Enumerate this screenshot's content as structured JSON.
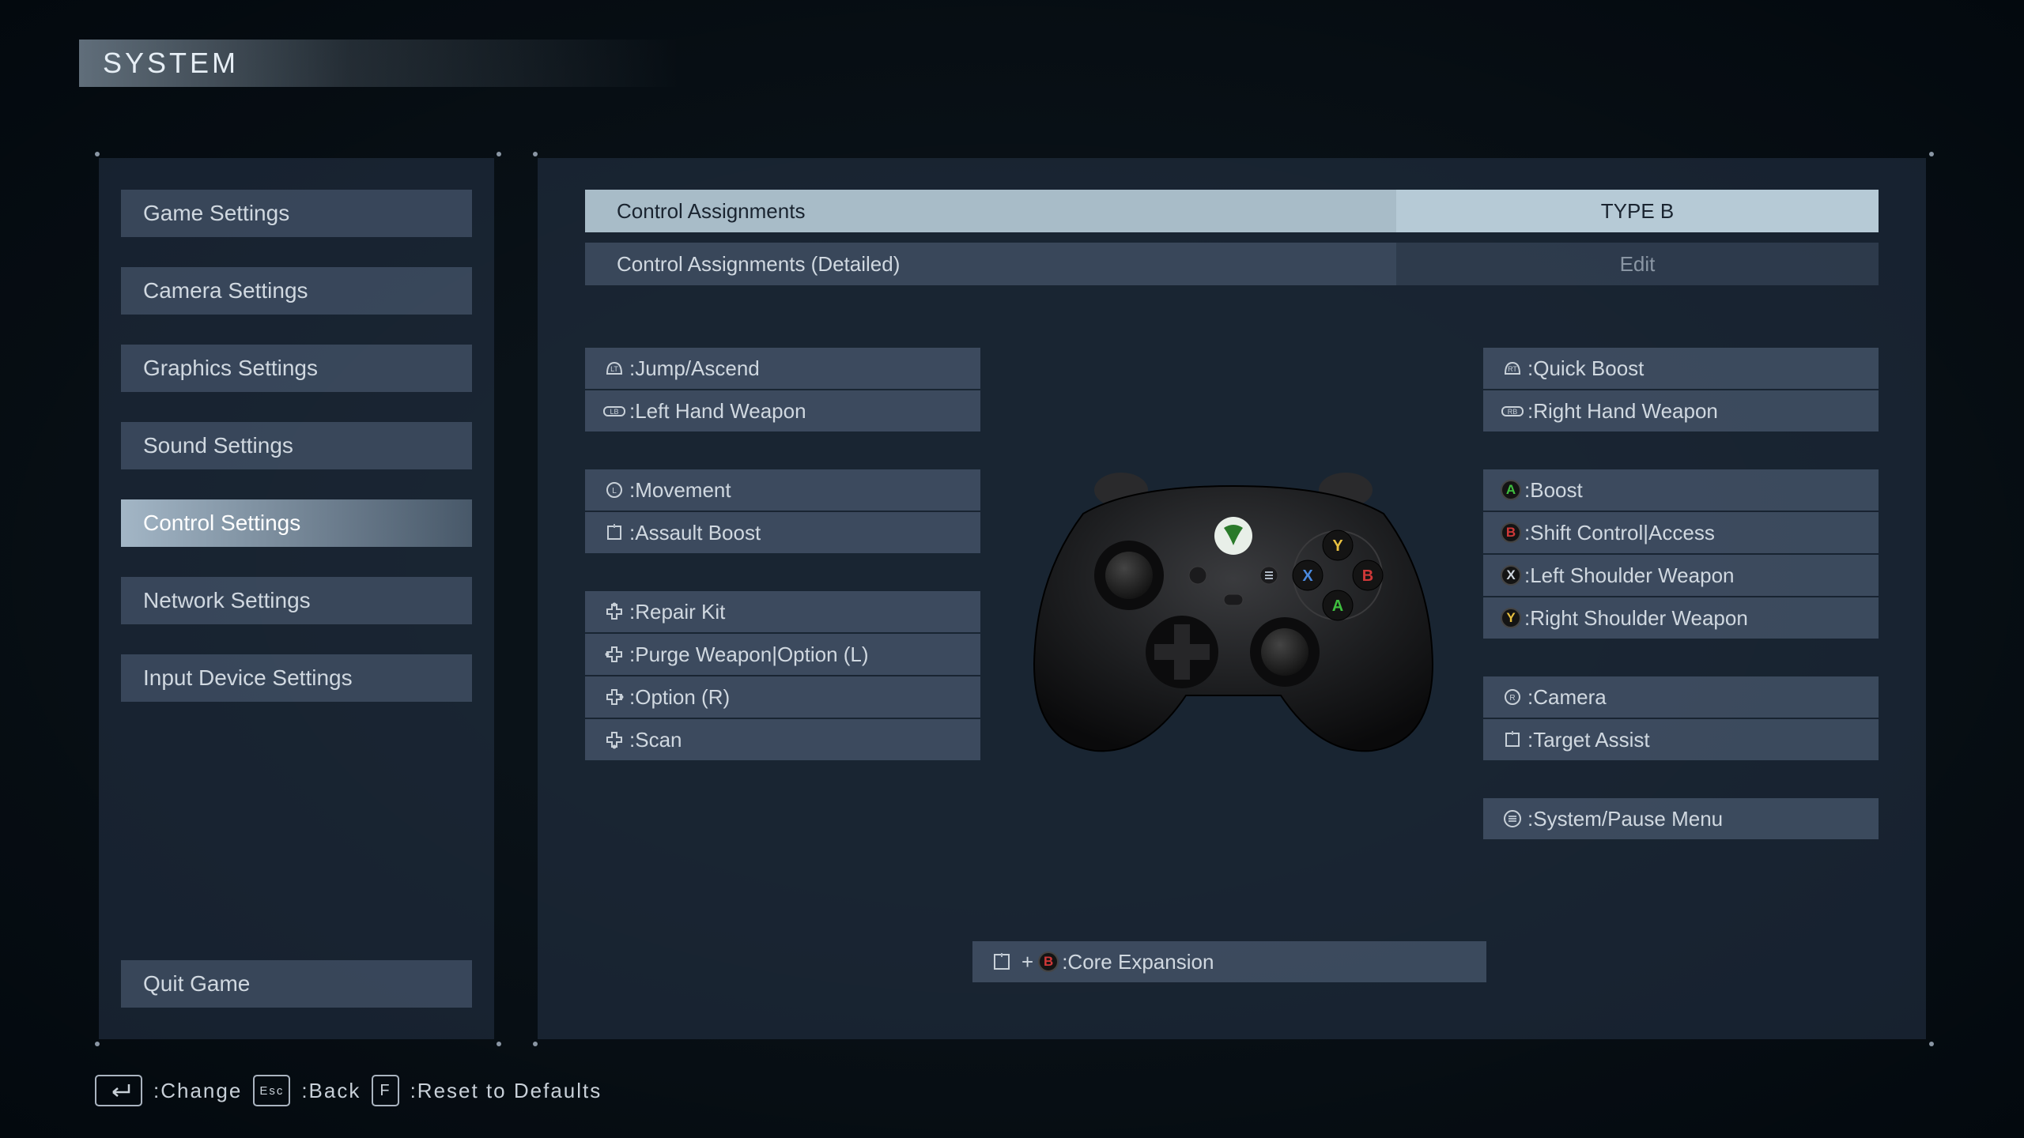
{
  "header": {
    "title": "SYSTEM"
  },
  "sidebar": {
    "items": [
      "Game Settings",
      "Camera Settings",
      "Graphics Settings",
      "Sound Settings",
      "Control Settings",
      "Network Settings",
      "Input Device Settings"
    ],
    "selected_index": 4,
    "quit": "Quit Game"
  },
  "top": {
    "row1": {
      "label": "Control Assignments",
      "value": "TYPE B"
    },
    "row2": {
      "label": "Control Assignments (Detailed)",
      "value": "Edit"
    }
  },
  "bindings": {
    "left_triggers": [
      {
        "icon": "LT",
        "label": ":Jump/Ascend"
      },
      {
        "icon": "LB",
        "label": ":Left Hand Weapon"
      }
    ],
    "left_stick": [
      {
        "icon": "LS",
        "label": ":Movement"
      },
      {
        "icon": "L3",
        "label": ":Assault Boost"
      }
    ],
    "dpad": [
      {
        "icon": "dpad-up",
        "label": ":Repair Kit"
      },
      {
        "icon": "dpad-left",
        "label": ":Purge Weapon|Option (L)"
      },
      {
        "icon": "dpad-right",
        "label": ":Option (R)"
      },
      {
        "icon": "dpad-down",
        "label": ":Scan"
      }
    ],
    "right_triggers": [
      {
        "icon": "RT",
        "label": ":Quick Boost"
      },
      {
        "icon": "RB",
        "label": ":Right Hand Weapon"
      }
    ],
    "face": [
      {
        "icon": "A",
        "color": "#3fbf3f",
        "label": ":Boost"
      },
      {
        "icon": "B",
        "color": "#d03838",
        "label": ":Shift Control|Access"
      },
      {
        "icon": "X",
        "color": "#cfd6de",
        "label": ":Left Shoulder Weapon"
      },
      {
        "icon": "Y",
        "color": "#e8c040",
        "label": ":Right Shoulder Weapon"
      }
    ],
    "right_stick": [
      {
        "icon": "RS",
        "label": ":Camera"
      },
      {
        "icon": "R3",
        "label": ":Target Assist"
      }
    ],
    "menu_btn": {
      "icon": "menu",
      "label": ":System/Pause Menu"
    },
    "combo": {
      "label": ":Core Expansion"
    }
  },
  "footer": {
    "change": ":Change",
    "back": ":Back",
    "reset": ":Reset to Defaults"
  }
}
